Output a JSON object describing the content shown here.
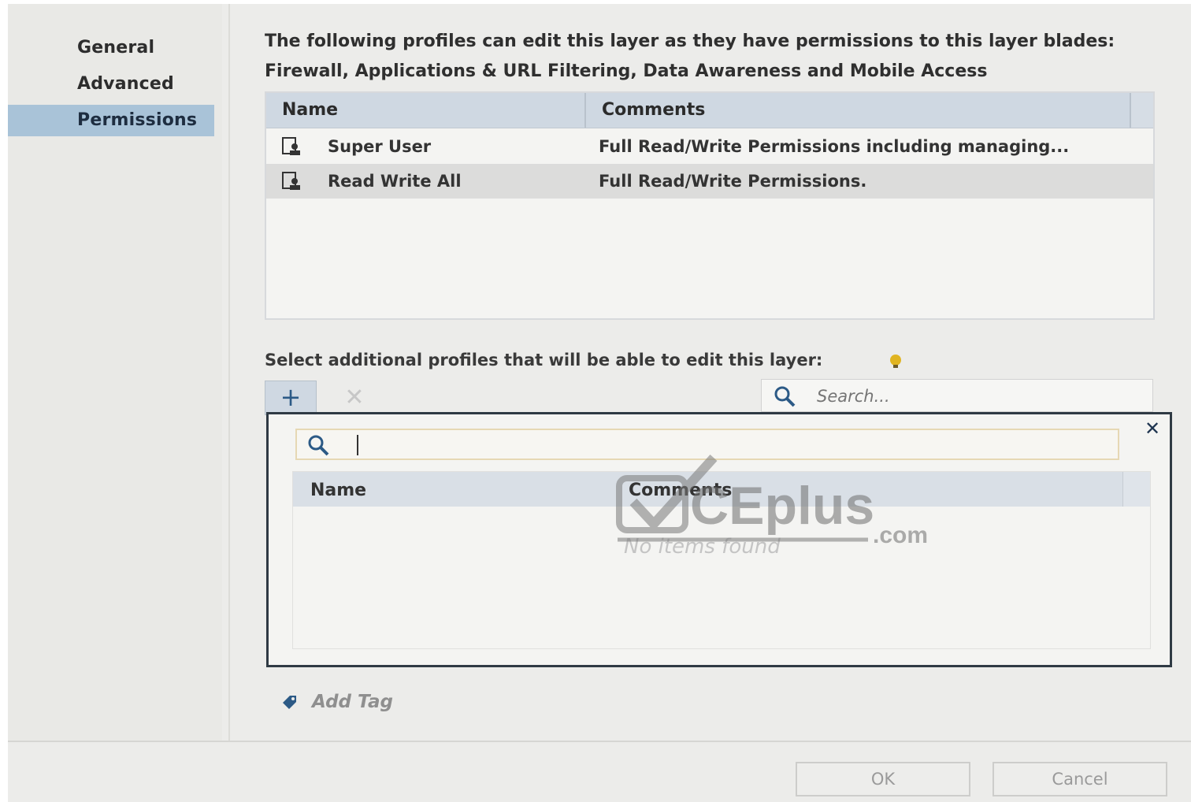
{
  "nav": {
    "items": [
      {
        "label": "General"
      },
      {
        "label": "Advanced"
      },
      {
        "label": "Permissions"
      }
    ]
  },
  "intro": {
    "line1": "The following profiles can edit this layer as they have permissions to this layer blades:",
    "line2": "Firewall, Applications & URL Filtering, Data Awareness and Mobile Access"
  },
  "profiles_table": {
    "columns": [
      "Name",
      "Comments"
    ],
    "rows": [
      {
        "name": "Super User",
        "comment": "Full Read/Write Permissions including managing..."
      },
      {
        "name": "Read Write All",
        "comment": "Full Read/Write Permissions."
      }
    ]
  },
  "additional": {
    "label": "Select additional profiles that will be able to edit this layer:",
    "add_symbol": "+",
    "remove_symbol": "✕",
    "search_placeholder": "Search..."
  },
  "popup": {
    "close_symbol": "✕",
    "columns": [
      "Name",
      "Comments"
    ],
    "empty_message": "No items found"
  },
  "watermark": {
    "text": "CEplus",
    "suffix": ".com"
  },
  "add_tag": {
    "label": "Add Tag"
  },
  "footer": {
    "ok_label": "OK",
    "cancel_label": "Cancel"
  },
  "icons": {
    "profile": "profile-icon",
    "hint": "lightbulb-icon",
    "search": "search-icon",
    "tag": "tag-icon"
  },
  "colors": {
    "nav_active": "#a9c3d8",
    "header_bg": "#cfd8e2",
    "popup_border": "#2f3a44",
    "accent_blue": "#2c5a86"
  }
}
